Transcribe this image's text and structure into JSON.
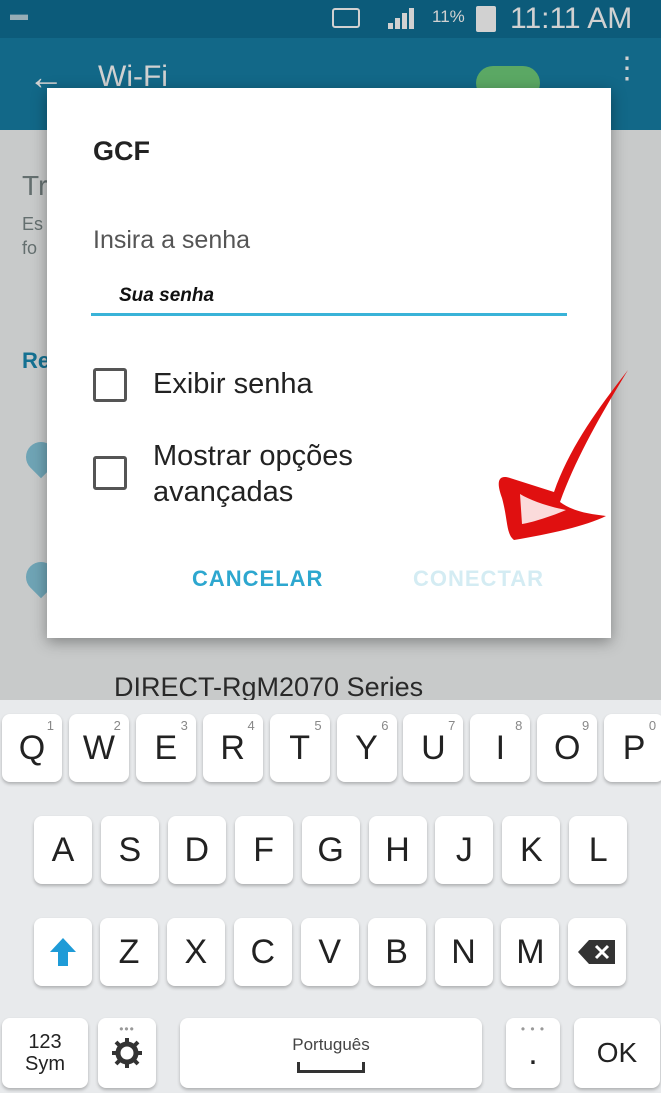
{
  "status_bar": {
    "battery": "11%",
    "time": "11:11 AM"
  },
  "app_bar": {
    "title": "Wi-Fi",
    "back_glyph": "←",
    "more_glyph": "⋮"
  },
  "background_fragments": {
    "t1": "Tr",
    "t2": "Es",
    "t3": "fo",
    "section": "Re",
    "network_name": "DIRECT-RgM2070 Series"
  },
  "dialog": {
    "title": "GCF",
    "password_label": "Insira a senha",
    "password_value": "Sua senha",
    "checkboxes": [
      {
        "label": "Exibir senha",
        "checked": false
      },
      {
        "label_line1": "Mostrar opções",
        "label_line2": "avançadas",
        "checked": false
      }
    ],
    "cancel_label": "CANCELAR",
    "connect_label": "CONECTAR"
  },
  "keyboard": {
    "row1": [
      {
        "k": "Q",
        "n": "1"
      },
      {
        "k": "W",
        "n": "2"
      },
      {
        "k": "E",
        "n": "3"
      },
      {
        "k": "R",
        "n": "4"
      },
      {
        "k": "T",
        "n": "5"
      },
      {
        "k": "Y",
        "n": "6"
      },
      {
        "k": "U",
        "n": "7"
      },
      {
        "k": "I",
        "n": "8"
      },
      {
        "k": "O",
        "n": "9"
      },
      {
        "k": "P",
        "n": "0"
      }
    ],
    "row2": [
      "A",
      "S",
      "D",
      "F",
      "G",
      "H",
      "J",
      "K",
      "L"
    ],
    "row3": [
      "Z",
      "X",
      "C",
      "V",
      "B",
      "N",
      "M"
    ],
    "sym_line1": "123",
    "sym_line2": "Sym",
    "space_label": "Português",
    "period": ".",
    "ok": "OK",
    "shift_icon": "shift-arrow-icon",
    "backspace_icon": "backspace-icon",
    "settings_icon": "gear-icon"
  },
  "colors": {
    "accent": "#2da7cf",
    "appbar": "#167fa6",
    "annotation": "#e01010"
  }
}
